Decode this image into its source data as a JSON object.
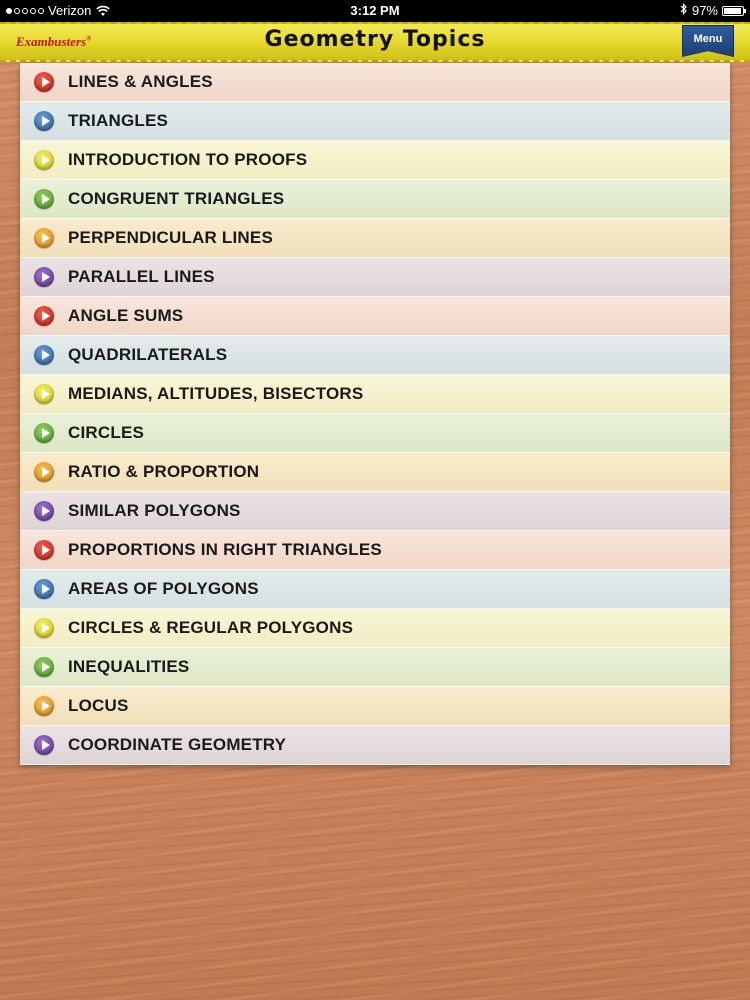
{
  "status_bar": {
    "carrier": "Verizon",
    "time": "3:12 PM",
    "battery": "97%",
    "battery_level": 0.97,
    "signal_bars_filled": 1,
    "signal_bars_total": 5
  },
  "header": {
    "brand": "Exambusters",
    "brand_mark": "®",
    "title": "Geometry Topics",
    "menu_label": "Menu",
    "colors": {
      "bar": "#e4d72a",
      "brand": "#c2161a",
      "menu": "#1d3f74"
    }
  },
  "topics": [
    {
      "label": "LINES & ANGLES",
      "color": "red"
    },
    {
      "label": "TRIANGLES",
      "color": "blue"
    },
    {
      "label": "INTRODUCTION TO PROOFS",
      "color": "yellow"
    },
    {
      "label": "CONGRUENT TRIANGLES",
      "color": "green"
    },
    {
      "label": "PERPENDICULAR LINES",
      "color": "orange"
    },
    {
      "label": "PARALLEL LINES",
      "color": "purple"
    },
    {
      "label": "ANGLE SUMS",
      "color": "red"
    },
    {
      "label": "QUADRILATERALS",
      "color": "blue"
    },
    {
      "label": "MEDIANS, ALTITUDES, BISECTORS",
      "color": "yellow"
    },
    {
      "label": "CIRCLES",
      "color": "green"
    },
    {
      "label": "RATIO & PROPORTION",
      "color": "orange"
    },
    {
      "label": "SIMILAR POLYGONS",
      "color": "purple"
    },
    {
      "label": "PROPORTIONS IN RIGHT TRIANGLES",
      "color": "red"
    },
    {
      "label": "AREAS OF POLYGONS",
      "color": "blue"
    },
    {
      "label": "CIRCLES & REGULAR POLYGONS",
      "color": "yellow"
    },
    {
      "label": "INEQUALITIES",
      "color": "green"
    },
    {
      "label": "LOCUS",
      "color": "orange"
    },
    {
      "label": "COORDINATE GEOMETRY",
      "color": "purple"
    }
  ],
  "icons": {
    "row_icon": "play-circle-icon",
    "wifi": "wifi-icon",
    "bluetooth": "bluetooth-icon",
    "battery": "battery-icon"
  }
}
